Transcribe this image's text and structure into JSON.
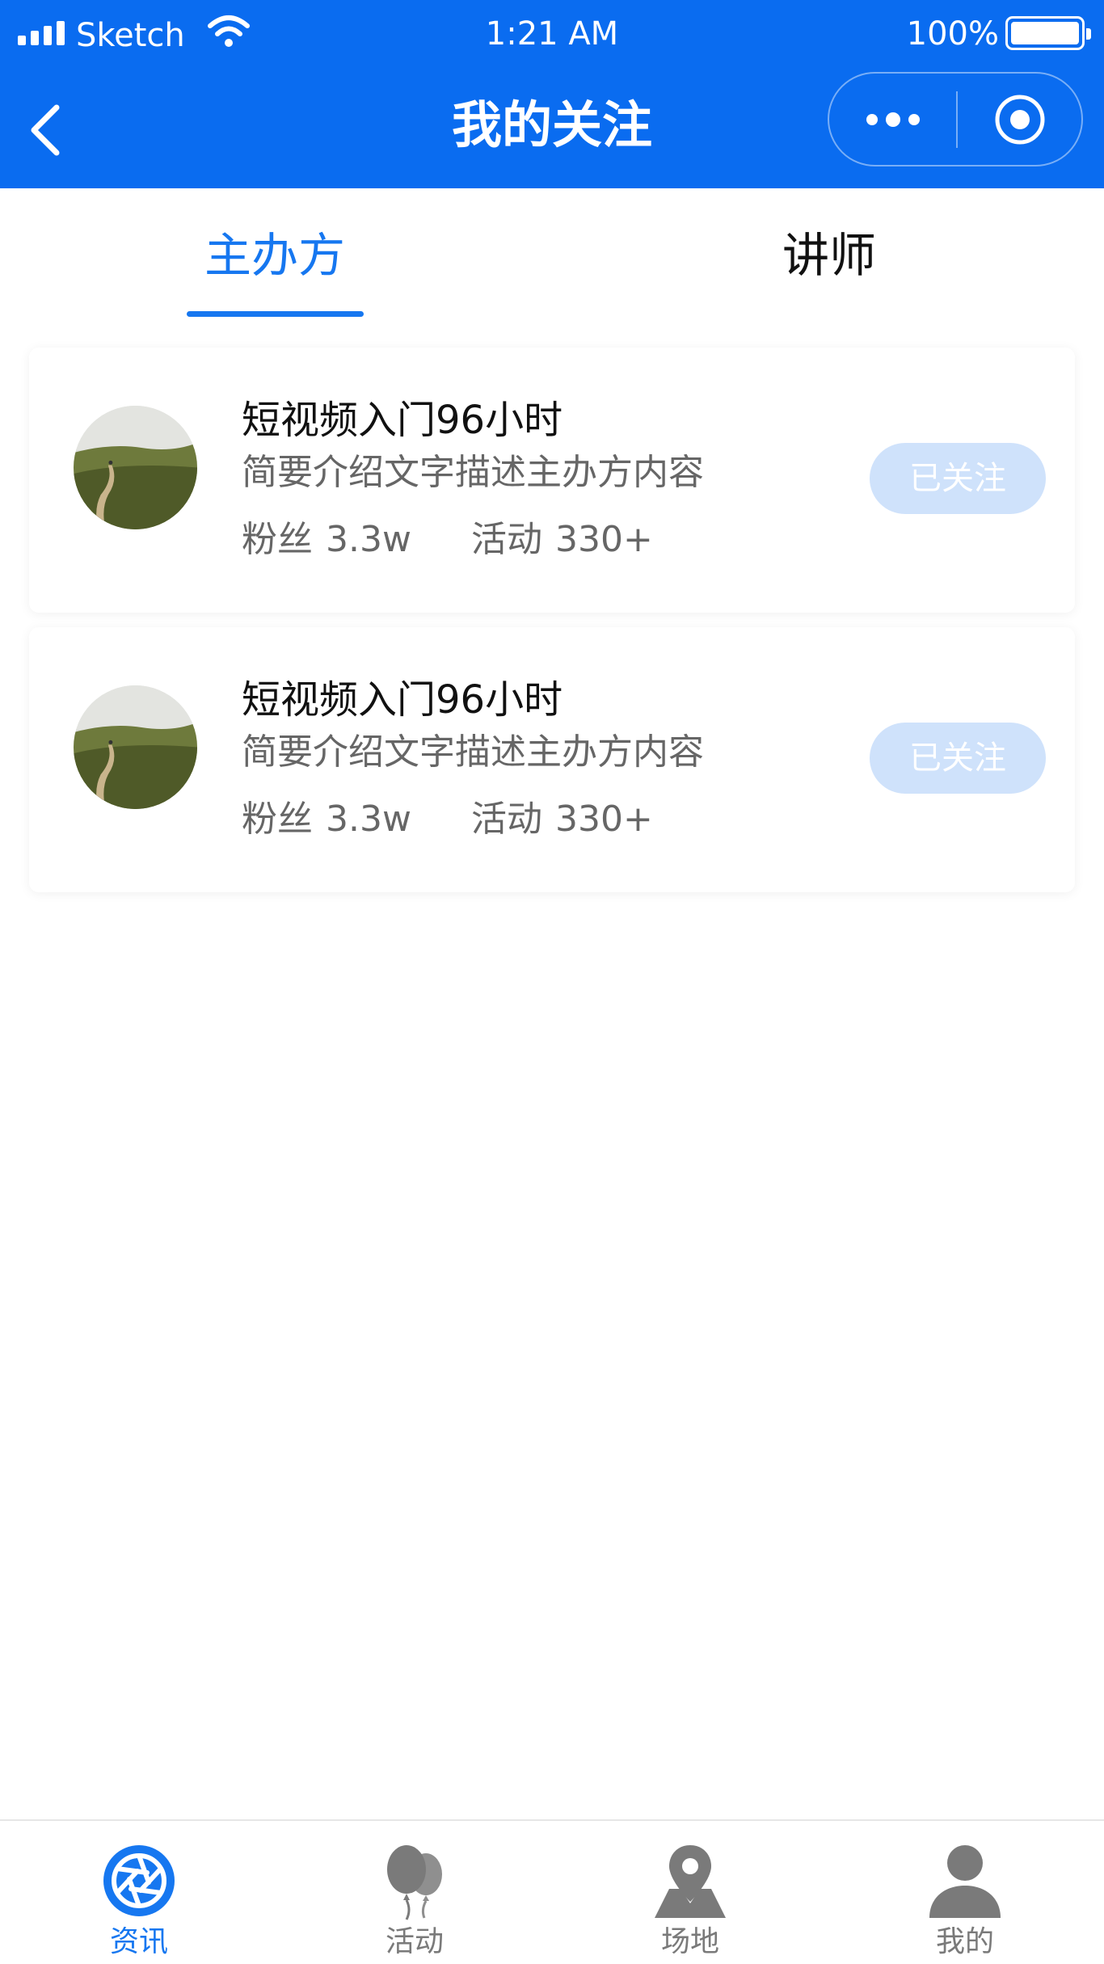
{
  "status_bar": {
    "carrier": "Sketch",
    "time": "1:21 AM",
    "battery": "100%"
  },
  "nav": {
    "title": "我的关注",
    "back_icon": "chevron-left-icon",
    "more_icon": "more-dots-icon",
    "target_icon": "target-circle-icon"
  },
  "tabs": [
    {
      "label": "主办方",
      "active": true
    },
    {
      "label": "讲师",
      "active": false
    }
  ],
  "organizers": [
    {
      "title": "短视频入门96小时",
      "description": "简要介绍文字描述主办方内容",
      "fans_label": "粉丝",
      "fans_value": "3.3w",
      "events_label": "活动",
      "events_value": "330+",
      "button_label": "已关注"
    },
    {
      "title": "短视频入门96小时",
      "description": "简要介绍文字描述主办方内容",
      "fans_label": "粉丝",
      "fans_value": "3.3w",
      "events_label": "活动",
      "events_value": "330+",
      "button_label": "已关注"
    }
  ],
  "tabbar": [
    {
      "label": "资讯",
      "icon": "aperture-icon",
      "active": true
    },
    {
      "label": "活动",
      "icon": "balloons-icon",
      "active": false
    },
    {
      "label": "场地",
      "icon": "map-pin-icon",
      "active": false
    },
    {
      "label": "我的",
      "icon": "user-icon",
      "active": false
    }
  ],
  "colors": {
    "primary": "#0A6CF0",
    "tab_active": "#1677F0",
    "follow_button_bg": "#CFE2FB",
    "text_primary": "#111111",
    "text_secondary": "#666666",
    "tabbar_inactive": "#7A7A7A"
  }
}
